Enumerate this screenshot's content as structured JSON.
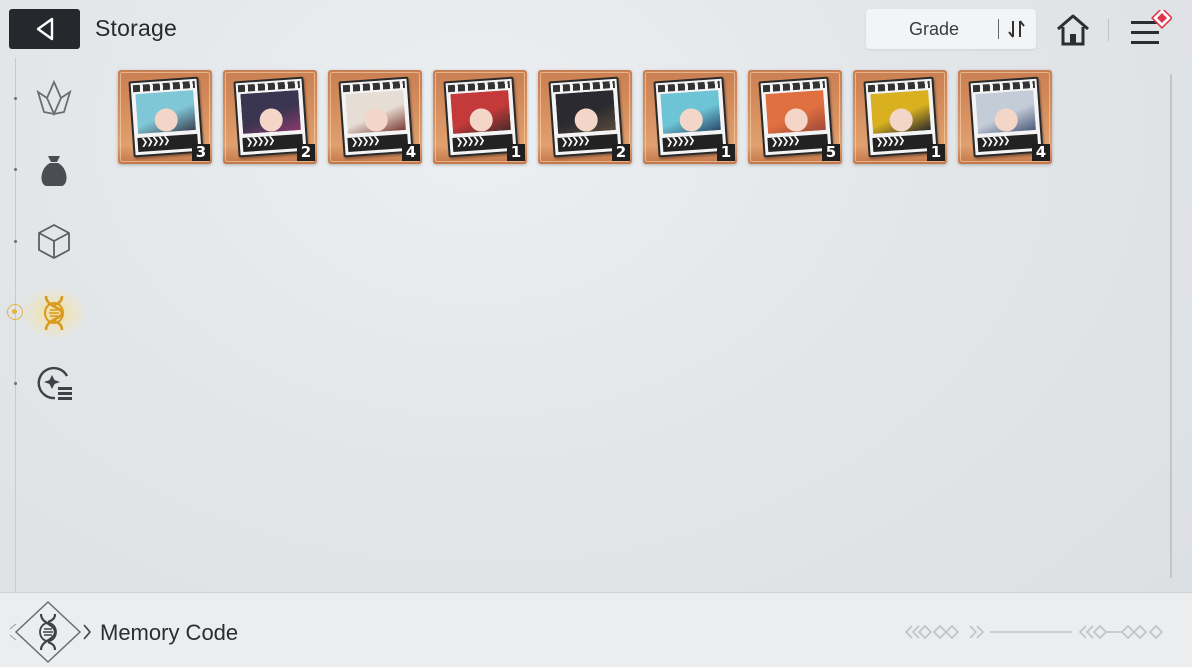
{
  "header": {
    "title": "Storage",
    "sort": {
      "label": "Grade"
    }
  },
  "icons": {
    "back": "back-arrow-icon",
    "sort": "sort-order-icon",
    "home": "home-icon",
    "menu": "menu-icon"
  },
  "colors": {
    "accent_gold": "#e6b43c",
    "card_orange": "#d48c5c",
    "notify_red": "#e2344a",
    "dark": "#25282c"
  },
  "sidebar": {
    "items": [
      {
        "name": "crystal-category",
        "icon": "crystal-icon",
        "selected": false
      },
      {
        "name": "bag-category",
        "icon": "pouch-icon",
        "selected": false
      },
      {
        "name": "box-category",
        "icon": "cube-icon",
        "selected": false
      },
      {
        "name": "memory-code-category",
        "icon": "dna-icon",
        "selected": true
      },
      {
        "name": "codex-category",
        "icon": "record-list-icon",
        "selected": false
      }
    ]
  },
  "items": [
    {
      "count": "3",
      "hair": "#7fc6d6",
      "accent": "#3b3f52"
    },
    {
      "count": "2",
      "hair": "#3a3550",
      "accent": "#8a3a6a"
    },
    {
      "count": "4",
      "hair": "#e6ddd4",
      "accent": "#7a3a34"
    },
    {
      "count": "1",
      "hair": "#c43a3a",
      "accent": "#4a2a2a"
    },
    {
      "count": "2",
      "hair": "#2a2a30",
      "accent": "#5a4a3a"
    },
    {
      "count": "1",
      "hair": "#6cc4d4",
      "accent": "#2a4a6a"
    },
    {
      "count": "5",
      "hair": "#e07040",
      "accent": "#a04a3a"
    },
    {
      "count": "1",
      "hair": "#d8b020",
      "accent": "#2a2a2a"
    },
    {
      "count": "4",
      "hair": "#c4ccd8",
      "accent": "#4a5a7a"
    }
  ],
  "footer": {
    "label": "Memory Code"
  }
}
